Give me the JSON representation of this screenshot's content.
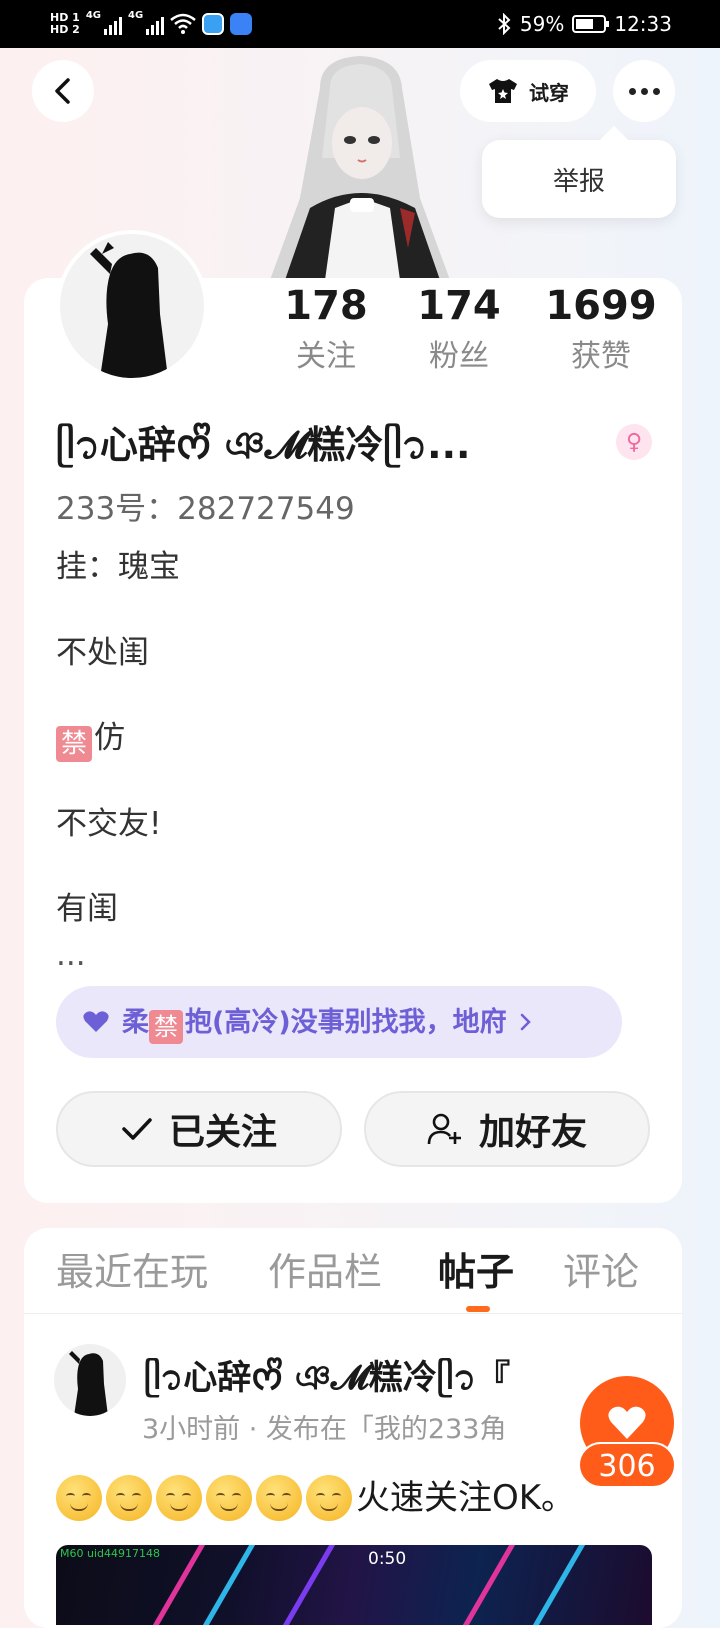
{
  "status_bar": {
    "hd1": "HD 1",
    "hd2": "HD 2",
    "net1": "4G",
    "net2": "4G",
    "battery": "59%",
    "time": "12:33"
  },
  "header": {
    "tryon_label": "试穿",
    "menu_item": "举报"
  },
  "profile": {
    "stats": [
      {
        "value": "178",
        "label": "关注"
      },
      {
        "value": "174",
        "label": "粉丝"
      },
      {
        "value": "1699",
        "label": "获赞"
      }
    ],
    "nickname": "ᥫ᭡心辞ᰔᩚ ঞ𝓜糕冷ᥫ᭡...",
    "gender_icon": "female-icon",
    "uid": "233号：282727549",
    "bio": {
      "line1": "挂：瑰宝",
      "line2": "不处闺",
      "ban_badge": "禁",
      "line3_rest": "仿",
      "line4": "不交友!",
      "line5": "有闺",
      "ellipsis": "..."
    },
    "guild": {
      "prefix": "柔",
      "ban_badge": "禁",
      "suffix": "抱(高冷)没事别找我，地府"
    },
    "followed_label": "已关注",
    "add_friend_label": "加好友"
  },
  "tabs": [
    {
      "label": "最近在玩",
      "active": false
    },
    {
      "label": "作品栏",
      "active": false
    },
    {
      "label": "帖子",
      "active": true
    },
    {
      "label": "评论",
      "active": false
    }
  ],
  "post": {
    "author": "ᥫ᭡心辞ᰔᩚ ঞ𝓜糕冷ᥫ᭡『",
    "meta": "3小时前 · 发布在「我的233角",
    "text": "火速关注OK。",
    "emoji_count": 6,
    "media": {
      "uid_label": "M60 uid44917148",
      "time": "0:50"
    },
    "like_count": "306"
  },
  "colors": {
    "accent_orange": "#ff5c1a",
    "guild_purple": "#6d5fd6",
    "ban_red": "#ef8a93"
  }
}
